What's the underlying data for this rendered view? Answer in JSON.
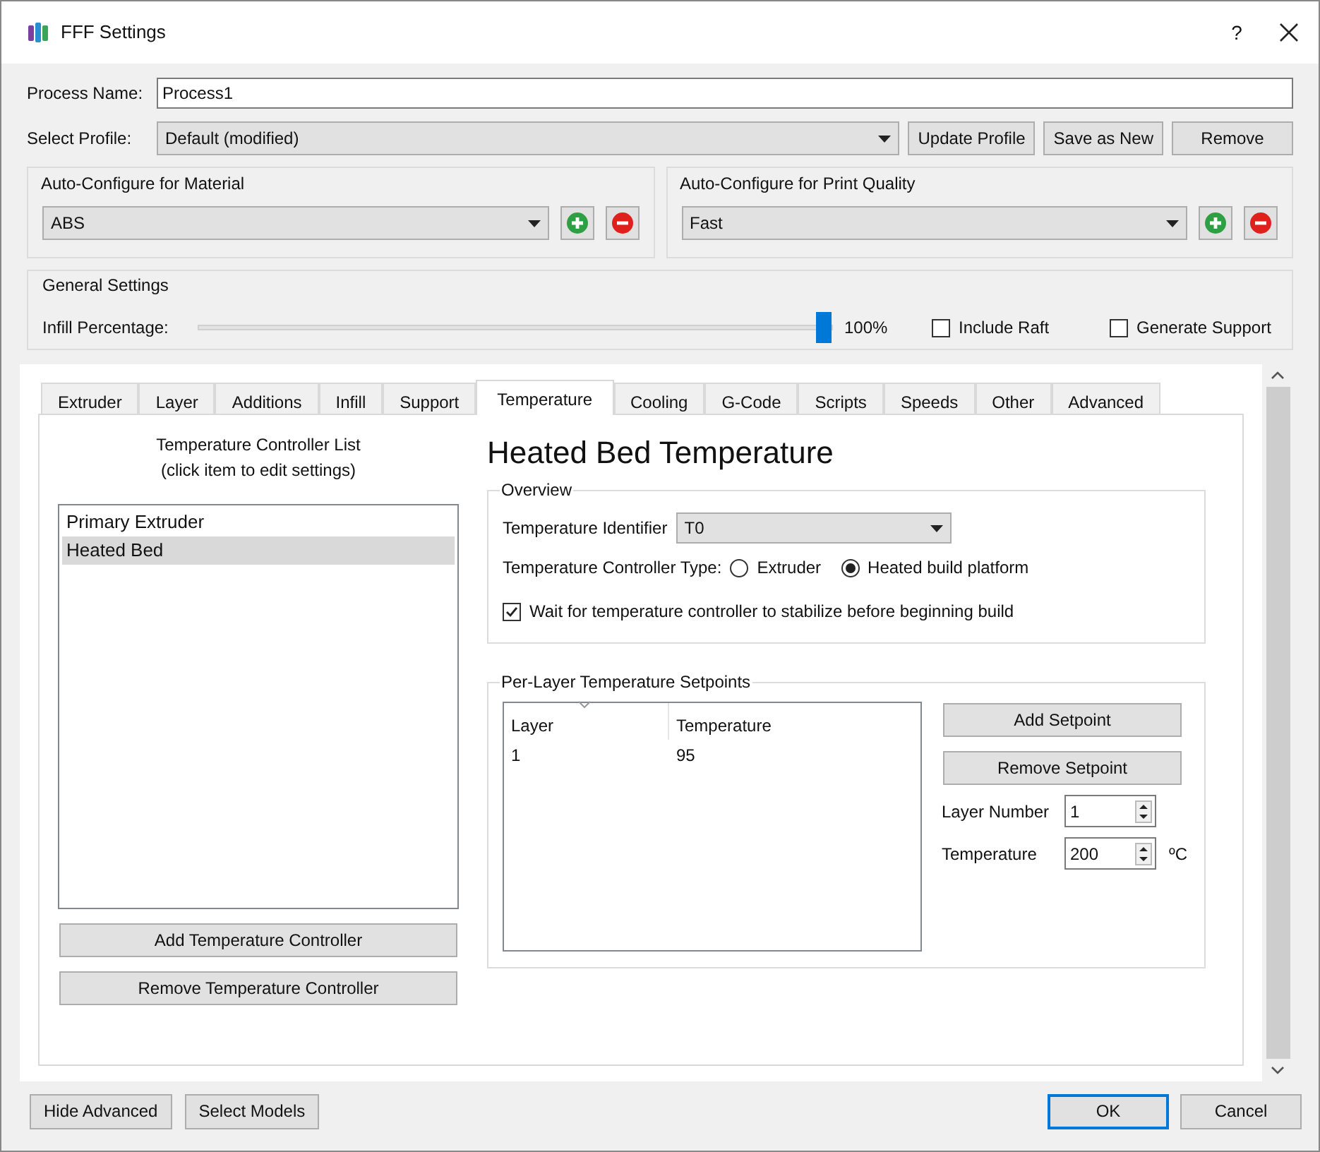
{
  "window": {
    "title": "FFF Settings",
    "help": "?"
  },
  "process_name": {
    "label": "Process Name:",
    "value": "Process1"
  },
  "profile": {
    "label": "Select Profile:",
    "value": "Default (modified)",
    "buttons": [
      "Update Profile",
      "Save as New",
      "Remove"
    ]
  },
  "material": {
    "title": "Auto-Configure for Material",
    "value": "ABS"
  },
  "quality": {
    "title": "Auto-Configure for Print Quality",
    "value": "Fast"
  },
  "general": {
    "title": "General Settings",
    "infill": {
      "label": "Infill Percentage:",
      "level": 1,
      "reading": "100%"
    },
    "checkboxes": [
      {
        "label": "Include Raft",
        "checked": false
      },
      {
        "label": "Generate Support",
        "checked": false
      }
    ]
  },
  "tabs": [
    {
      "label": "Extruder",
      "selected": false
    },
    {
      "label": "Layer",
      "selected": false
    },
    {
      "label": "Additions",
      "selected": false
    },
    {
      "label": "Infill",
      "selected": false
    },
    {
      "label": "Support",
      "selected": false
    },
    {
      "label": "Temperature",
      "selected": true
    },
    {
      "label": "Cooling",
      "selected": false
    },
    {
      "label": "G-Code",
      "selected": false
    },
    {
      "label": "Scripts",
      "selected": false
    },
    {
      "label": "Speeds",
      "selected": false
    },
    {
      "label": "Other",
      "selected": false
    },
    {
      "label": "Advanced",
      "selected": false
    }
  ],
  "controllers": {
    "title": "Temperature Controller List",
    "subtitle": "(click item to edit settings)",
    "items": [
      {
        "label": "Primary Extruder",
        "selected": false
      },
      {
        "label": "Heated Bed",
        "selected": true
      }
    ],
    "buttons": [
      "Add Temperature Controller",
      "Remove Temperature Controller"
    ]
  },
  "detail": {
    "heading": "Heated Bed Temperature",
    "overview": {
      "title": "Overview",
      "identifier": {
        "label": "Temperature Identifier",
        "value": "T0"
      },
      "type": {
        "label": "Temperature Controller Type:",
        "options": [
          {
            "label": "Extruder",
            "selected": false
          },
          {
            "label": "Heated build platform",
            "selected": true
          }
        ]
      },
      "wait": {
        "label": "Wait for temperature controller to stabilize before beginning build",
        "checked": true
      }
    },
    "setpoints": {
      "title": "Per-Layer Temperature Setpoints",
      "columns": [
        "Layer",
        "Temperature"
      ],
      "rows": [
        [
          "1",
          "95"
        ]
      ],
      "buttons": [
        "Add Setpoint",
        "Remove Setpoint"
      ],
      "layer_number": {
        "label": "Layer Number",
        "value": "1"
      },
      "temperature": {
        "label": "Temperature",
        "value": "200",
        "unit": "ºC"
      }
    }
  },
  "footer": {
    "left": [
      "Hide Advanced",
      "Select Models"
    ],
    "right": [
      {
        "label": "OK",
        "default": true
      },
      {
        "label": "Cancel",
        "default": false
      }
    ]
  }
}
